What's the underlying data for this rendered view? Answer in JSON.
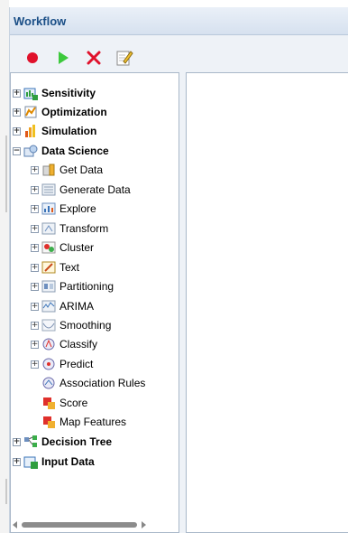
{
  "panel": {
    "title": "Workflow"
  },
  "toolbar": [
    {
      "name": "record-button",
      "icon": "red-dot-icon"
    },
    {
      "name": "run-button",
      "icon": "green-play-icon"
    },
    {
      "name": "delete-button",
      "icon": "red-x-icon"
    },
    {
      "name": "edit-button",
      "icon": "pencil-notepad-icon"
    }
  ],
  "tree": [
    {
      "label": "Sensitivity",
      "level": 0,
      "expander": "plus",
      "bold": true,
      "icon": "sensitivity-icon"
    },
    {
      "label": "Optimization",
      "level": 0,
      "expander": "plus",
      "bold": true,
      "icon": "optimization-icon"
    },
    {
      "label": "Simulation",
      "level": 0,
      "expander": "plus",
      "bold": true,
      "icon": "simulation-icon"
    },
    {
      "label": "Data Science",
      "level": 0,
      "expander": "minus",
      "bold": true,
      "icon": "data-science-icon"
    },
    {
      "label": "Get Data",
      "level": 1,
      "expander": "plus",
      "icon": "get-data-icon"
    },
    {
      "label": "Generate Data",
      "level": 1,
      "expander": "plus",
      "icon": "generate-data-icon"
    },
    {
      "label": "Explore",
      "level": 1,
      "expander": "plus",
      "icon": "explore-icon"
    },
    {
      "label": "Transform",
      "level": 1,
      "expander": "plus",
      "icon": "transform-icon"
    },
    {
      "label": "Cluster",
      "level": 1,
      "expander": "plus",
      "icon": "cluster-icon"
    },
    {
      "label": "Text",
      "level": 1,
      "expander": "plus",
      "icon": "text-icon"
    },
    {
      "label": "Partitioning",
      "level": 1,
      "expander": "plus",
      "icon": "partitioning-icon"
    },
    {
      "label": "ARIMA",
      "level": 1,
      "expander": "plus",
      "icon": "arima-icon"
    },
    {
      "label": "Smoothing",
      "level": 1,
      "expander": "plus",
      "icon": "smoothing-icon"
    },
    {
      "label": "Classify",
      "level": 1,
      "expander": "plus",
      "icon": "classify-icon"
    },
    {
      "label": "Predict",
      "level": 1,
      "expander": "plus",
      "icon": "predict-icon"
    },
    {
      "label": "Association Rules",
      "level": 1,
      "expander": "none",
      "icon": "association-rules-icon"
    },
    {
      "label": "Score",
      "level": 1,
      "expander": "none",
      "icon": "score-icon"
    },
    {
      "label": "Map Features",
      "level": 1,
      "expander": "none",
      "icon": "map-features-icon"
    },
    {
      "label": "Decision Tree",
      "level": 0,
      "expander": "plus",
      "bold": true,
      "icon": "decision-tree-icon"
    },
    {
      "label": "Input Data",
      "level": 0,
      "expander": "plus",
      "bold": true,
      "icon": "input-data-icon"
    }
  ],
  "scroll": {
    "horizontal_thumb_fraction": 0.85
  }
}
